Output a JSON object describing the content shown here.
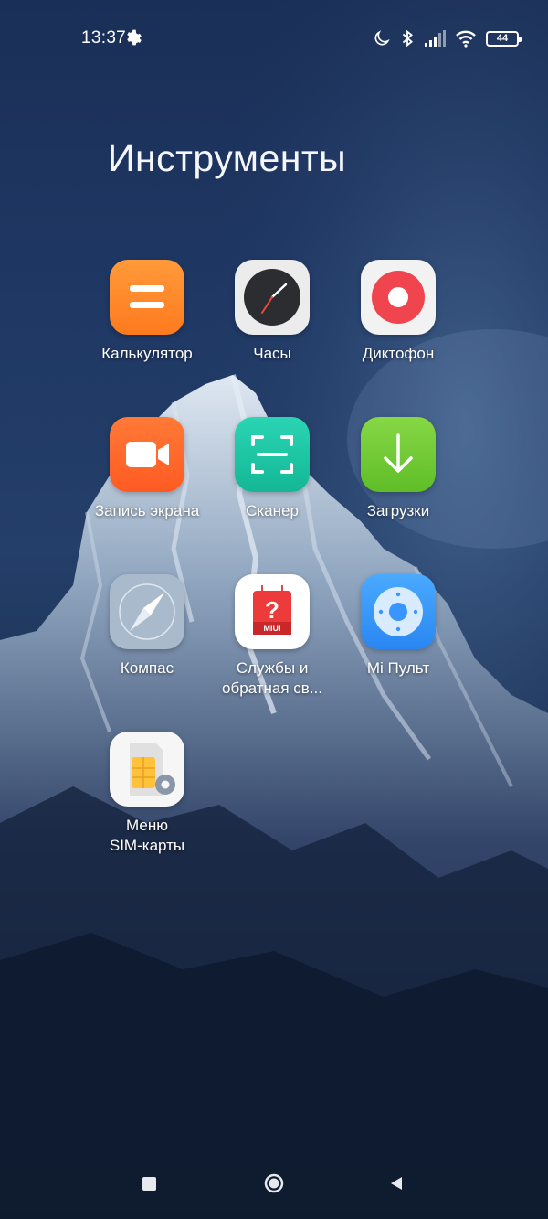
{
  "status_bar": {
    "time": "13:37",
    "battery_level": "44",
    "icons": [
      "settings-icon",
      "dnd-moon-icon",
      "bluetooth-icon",
      "signal-icon",
      "wifi-icon",
      "battery-icon"
    ]
  },
  "folder": {
    "title": "Инструменты"
  },
  "apps": [
    {
      "id": "calculator",
      "label": "Калькулятор",
      "icon": "calculator-icon",
      "color": "#ff8a2a"
    },
    {
      "id": "clock",
      "label": "Часы",
      "icon": "clock-icon",
      "color": "#e9e9ea"
    },
    {
      "id": "recorder",
      "label": "Диктофон",
      "icon": "recorder-icon",
      "color": "#f1f1f2"
    },
    {
      "id": "screen-recorder",
      "label": "Запись экрана",
      "icon": "video-camera-icon",
      "color": "#ff6a2a"
    },
    {
      "id": "scanner",
      "label": "Сканер",
      "icon": "scanner-icon",
      "color": "#21c8a7"
    },
    {
      "id": "downloads",
      "label": "Загрузки",
      "icon": "download-arrow-icon",
      "color": "#7cd13c"
    },
    {
      "id": "compass",
      "label": "Компас",
      "icon": "compass-icon",
      "color": "#a7b8cb"
    },
    {
      "id": "feedback",
      "label_line1": "Службы и",
      "label_line2": "обратная св...",
      "icon": "miui-feedback-icon",
      "color": "#ffffff",
      "badge": "MIUI"
    },
    {
      "id": "mi-remote",
      "label": "Mi Пульт",
      "icon": "remote-icon",
      "color": "#3a9bff"
    },
    {
      "id": "sim-menu",
      "label_line1": "Меню",
      "label_line2": "SIM-карты",
      "icon": "sim-card-icon",
      "color": "#f5f5f5"
    }
  ],
  "nav_bar": {
    "buttons": [
      "recents-square-icon",
      "home-circle-icon",
      "back-triangle-icon"
    ]
  }
}
